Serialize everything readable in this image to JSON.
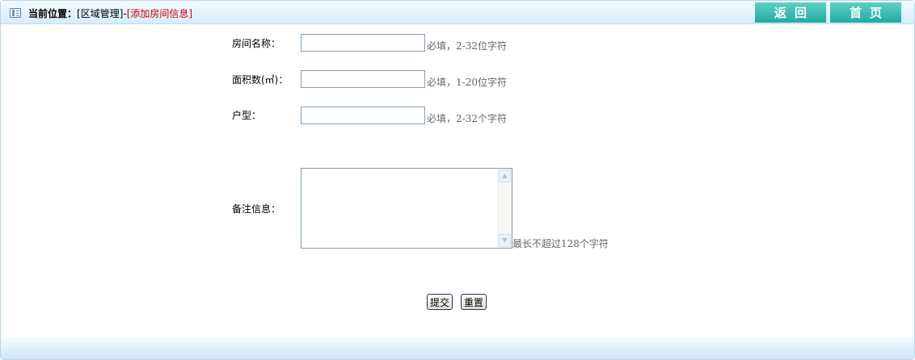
{
  "breadcrumb": {
    "label": "当前位置：",
    "section": "[区域管理]-",
    "current": "[添加房间信息]"
  },
  "topnav": {
    "back_label": "返回",
    "home_label": "首页"
  },
  "form": {
    "room_name": {
      "label": "房间名称：",
      "value": "",
      "hint": "必填，2-32位字符"
    },
    "area": {
      "label": "面积数(㎡)：",
      "value": "",
      "hint": "必填，1-20位字符"
    },
    "layout": {
      "label": "户型：",
      "value": "",
      "hint": "必填，2-32个字符"
    },
    "remarks": {
      "label": "备注信息：",
      "value": "",
      "hint": "最长不超过128个字符"
    }
  },
  "actions": {
    "submit_label": "提交",
    "reset_label": "重置"
  },
  "icons": {
    "breadcrumb": "window-icon",
    "scroll_up": "scroll-up-arrow-icon",
    "scroll_down": "scroll-down-arrow-icon"
  },
  "colors": {
    "accent_button": "#22aaa4",
    "breadcrumb_current": "#cc0000",
    "hint_text": "#666666",
    "header_bg": "#d6ecfb"
  }
}
